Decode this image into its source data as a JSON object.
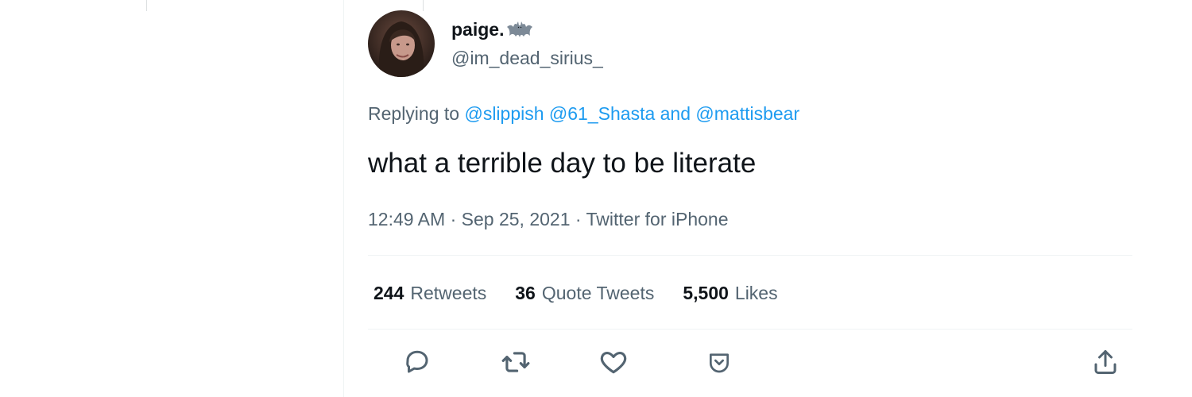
{
  "tweet": {
    "author": {
      "display_name": "paige.",
      "handle": "@im_dead_sirius_",
      "name_emoji_icon": "bat-icon"
    },
    "replying_to": {
      "prefix": "Replying to",
      "mentions": [
        "@slippish",
        "@61_Shasta"
      ],
      "connector": "and",
      "last_mention": "@mattisbear"
    },
    "text": "what a terrible day to be literate",
    "meta": {
      "time": "12:49 AM",
      "separator": "·",
      "date": "Sep 25, 2021",
      "source": "Twitter for iPhone"
    },
    "stats": [
      {
        "count": "244",
        "label": "Retweets"
      },
      {
        "count": "36",
        "label": "Quote Tweets"
      },
      {
        "count": "5,500",
        "label": "Likes"
      }
    ],
    "actions": [
      "reply-icon",
      "retweet-icon",
      "like-icon",
      "downvote-icon",
      "share-icon"
    ]
  },
  "colors": {
    "text_primary": "#0f1419",
    "text_secondary": "#536471",
    "link": "#1d9bf0",
    "divider": "#eff3f4"
  }
}
